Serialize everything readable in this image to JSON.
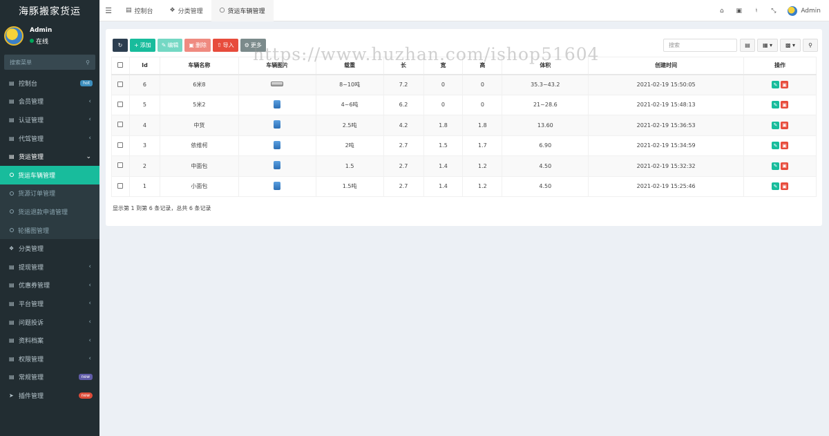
{
  "app": {
    "title": "海豚搬家货运"
  },
  "user": {
    "name": "Admin",
    "status": "在线"
  },
  "sidebar": {
    "search_placeholder": "搜索菜单",
    "items": [
      {
        "label": "控制台",
        "badge": "hot"
      },
      {
        "label": "会员管理"
      },
      {
        "label": "认证管理"
      },
      {
        "label": "代驾管理"
      },
      {
        "label": "货运管理"
      },
      {
        "label": "分类管理"
      },
      {
        "label": "提现管理"
      },
      {
        "label": "优惠券管理"
      },
      {
        "label": "平台管理"
      },
      {
        "label": "问题投诉"
      },
      {
        "label": "资料档案"
      },
      {
        "label": "权限管理"
      },
      {
        "label": "常规管理",
        "badge": "new"
      },
      {
        "label": "插件管理",
        "badge": "new"
      }
    ],
    "subitems": [
      {
        "label": "货运车辆管理"
      },
      {
        "label": "货源订单管理"
      },
      {
        "label": "货运退款申请管理"
      },
      {
        "label": "轮播图管理"
      }
    ]
  },
  "topbar": {
    "tabs": [
      {
        "label": "控制台"
      },
      {
        "label": "分类管理"
      },
      {
        "label": "货运车辆管理"
      }
    ],
    "user_label": "Admin"
  },
  "toolbar": {
    "add_label": "添加",
    "edit_label": "编辑",
    "delete_label": "删除",
    "import_label": "导入",
    "more_label": "更多",
    "search_placeholder": "搜索"
  },
  "table": {
    "columns": [
      "Id",
      "车辆名称",
      "车辆图片",
      "载重",
      "长",
      "宽",
      "高",
      "体积",
      "创建时间",
      "操作"
    ],
    "rows": [
      {
        "id": "6",
        "name": "6米8",
        "load": "8~10吨",
        "length": "7.2",
        "width": "0",
        "height": "0",
        "volume": "35.3~43.2",
        "created": "2021-02-19 15:50:05"
      },
      {
        "id": "5",
        "name": "5米2",
        "load": "4~6吨",
        "length": "6.2",
        "width": "0",
        "height": "0",
        "volume": "21~28.6",
        "created": "2021-02-19 15:48:13"
      },
      {
        "id": "4",
        "name": "中货",
        "load": "2.5吨",
        "length": "4.2",
        "width": "1.8",
        "height": "1.8",
        "volume": "13.60",
        "created": "2021-02-19 15:36:53"
      },
      {
        "id": "3",
        "name": "依维柯",
        "load": "2吨",
        "length": "2.7",
        "width": "1.5",
        "height": "1.7",
        "volume": "6.90",
        "created": "2021-02-19 15:34:59"
      },
      {
        "id": "2",
        "name": "中面包",
        "load": "1.5",
        "length": "2.7",
        "width": "1.4",
        "height": "1.2",
        "volume": "4.50",
        "created": "2021-02-19 15:32:32"
      },
      {
        "id": "1",
        "name": "小面包",
        "load": "1.5吨",
        "length": "2.7",
        "width": "1.4",
        "height": "1.2",
        "volume": "4.50",
        "created": "2021-02-19 15:25:46"
      }
    ]
  },
  "footer": {
    "info": "显示第 1 到第 6 条记录，总共 6 条记录"
  },
  "watermark": "https://www.huzhan.com/ishop51604"
}
